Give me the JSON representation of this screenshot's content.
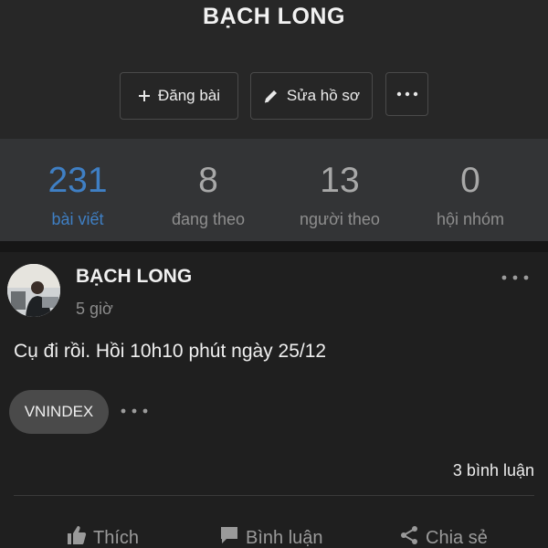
{
  "header": {
    "profile_name": "BẠCH LONG",
    "post_button": "Đăng bài",
    "post_icon": "plus-icon",
    "edit_button": "Sửa hồ sơ",
    "edit_icon": "pencil-icon",
    "more_icon": "more-horizontal-icon"
  },
  "stats": [
    {
      "value": "231",
      "label": "bài viết",
      "active": true
    },
    {
      "value": "8",
      "label": "đang theo",
      "active": false
    },
    {
      "value": "13",
      "label": "người theo",
      "active": false
    },
    {
      "value": "0",
      "label": "hội nhóm",
      "active": false
    }
  ],
  "post": {
    "author": "BẠCH LONG",
    "time": "5 giờ",
    "text": "Cụ đi rồi. Hồi 10h10 phút ngày 25/12",
    "tag": "VNINDEX",
    "comments": "3 bình luận",
    "actions": {
      "like": "Thích",
      "comment": "Bình luận",
      "share": "Chia sẻ"
    }
  },
  "colors": {
    "accent": "#3f7fc4",
    "background": "#1f1f1f",
    "stats_bg": "#333436"
  }
}
